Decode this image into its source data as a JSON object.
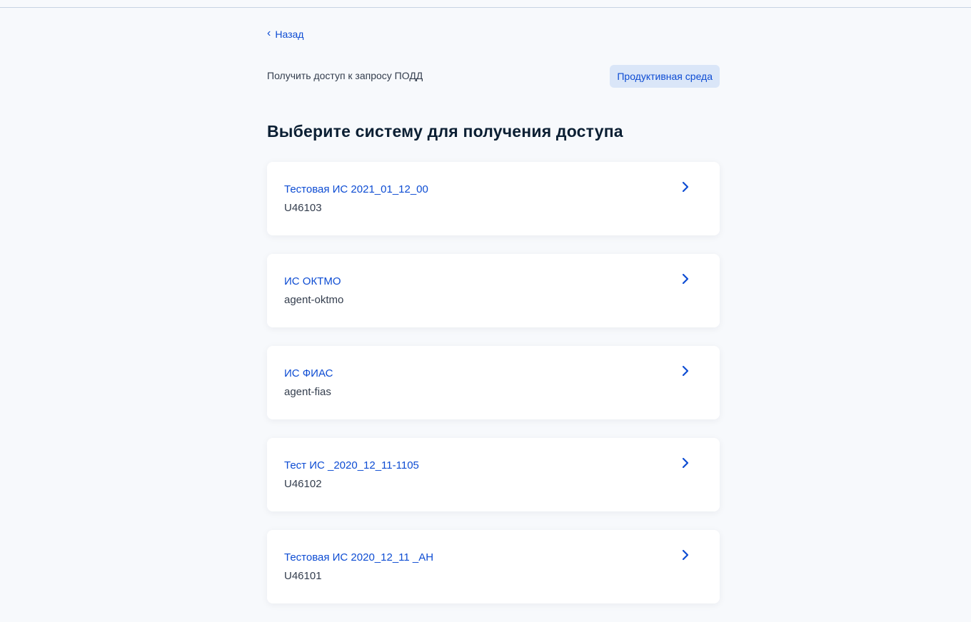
{
  "nav": {
    "back_label": "Назад"
  },
  "subheader": {
    "text": "Получить доступ к запросу ПОДД",
    "environment_badge": "Продуктивная среда"
  },
  "page": {
    "title": "Выберите систему для получения доступа"
  },
  "systems": [
    {
      "name": "Тестовая ИС 2021_01_12_00",
      "code": "U46103"
    },
    {
      "name": "ИС ОКТМО",
      "code": "agent-oktmo"
    },
    {
      "name": "ИС ФИАС",
      "code": "agent-fias"
    },
    {
      "name": "Тест ИС _2020_12_11-1105",
      "code": "U46102"
    },
    {
      "name": "Тестовая ИС 2020_12_11 _АН",
      "code": "U46101"
    }
  ],
  "colors": {
    "accent": "#0d4cd3",
    "background": "#f7f9fc",
    "badge_bg": "#dae6f8",
    "text_primary": "#0b1f33",
    "text_secondary": "#333d4d"
  },
  "icons": {
    "back": "chevron-left-icon",
    "card_arrow": "chevron-right-icon"
  }
}
